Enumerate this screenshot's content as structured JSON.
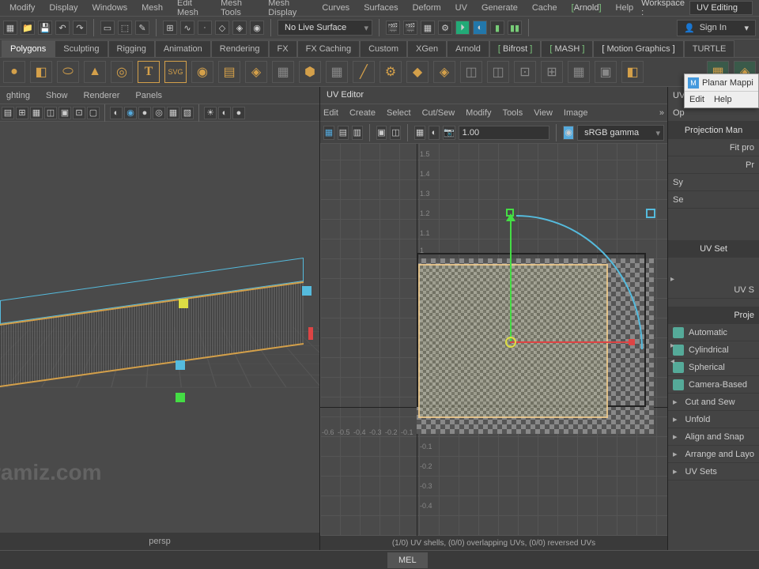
{
  "menubar": {
    "items": [
      "Modify",
      "Display",
      "Windows",
      "Mesh",
      "Edit Mesh",
      "Mesh Tools",
      "Mesh Display",
      "Curves",
      "Surfaces",
      "Deform",
      "UV",
      "Generate",
      "Cache",
      "Arnold",
      "Help"
    ],
    "workspace_label": "Workspace :",
    "workspace_value": "UV Editing"
  },
  "toolbar1": {
    "live_surface": "No Live Surface",
    "signin": "Sign In"
  },
  "shelf_tabs": [
    "Polygons",
    "Sculpting",
    "Rigging",
    "Animation",
    "Rendering",
    "FX",
    "FX Caching",
    "Custom",
    "XGen",
    "Arnold",
    "Bifrost",
    "MASH",
    "Motion Graphics",
    "TURTLE"
  ],
  "viewport": {
    "menu": [
      "ghting",
      "Show",
      "Renderer",
      "Panels"
    ],
    "camera": "persp",
    "watermark": "ramiz.com"
  },
  "uv": {
    "title": "UV Editor",
    "menu": [
      "Edit",
      "Create",
      "Select",
      "Cut/Sew",
      "Modify",
      "Tools",
      "View",
      "Image"
    ],
    "gamma": "sRGB gamma",
    "exposure": "1.00",
    "ticks_y": [
      "1.5",
      "1.4",
      "1.3",
      "1.2",
      "1.1",
      "1"
    ],
    "ticks_y2": [
      "-0.1",
      "-0.2",
      "-0.3",
      "-0.4"
    ],
    "ticks_x": [
      "-0.6",
      "-0.5",
      "-0.4",
      "-0.3",
      "-0.2",
      "-0.1"
    ],
    "status": "(1/0) UV shells, (0/0) overlapping UVs, (0/0) reversed UVs"
  },
  "rpanel": {
    "uv_label": "UV",
    "op_label": "Op",
    "sy_label": "Sy",
    "se_label": "Se",
    "proj_mani": "Projection Man",
    "fit": "Fit pro",
    "pc": "Pr",
    "uvset_hdr": "UV Set",
    "uvset_item": "UV S",
    "proj_hdr": "Proje",
    "items": [
      "Automatic",
      "Cylindrical",
      "Spherical",
      "Camera-Based",
      "Cut and Sew",
      "Unfold",
      "Align and Snap",
      "Arrange and Layo",
      "UV Sets"
    ]
  },
  "popup": {
    "title": "Planar Mappi",
    "menu": [
      "Edit",
      "Help"
    ]
  },
  "status": {
    "mel": "MEL"
  }
}
